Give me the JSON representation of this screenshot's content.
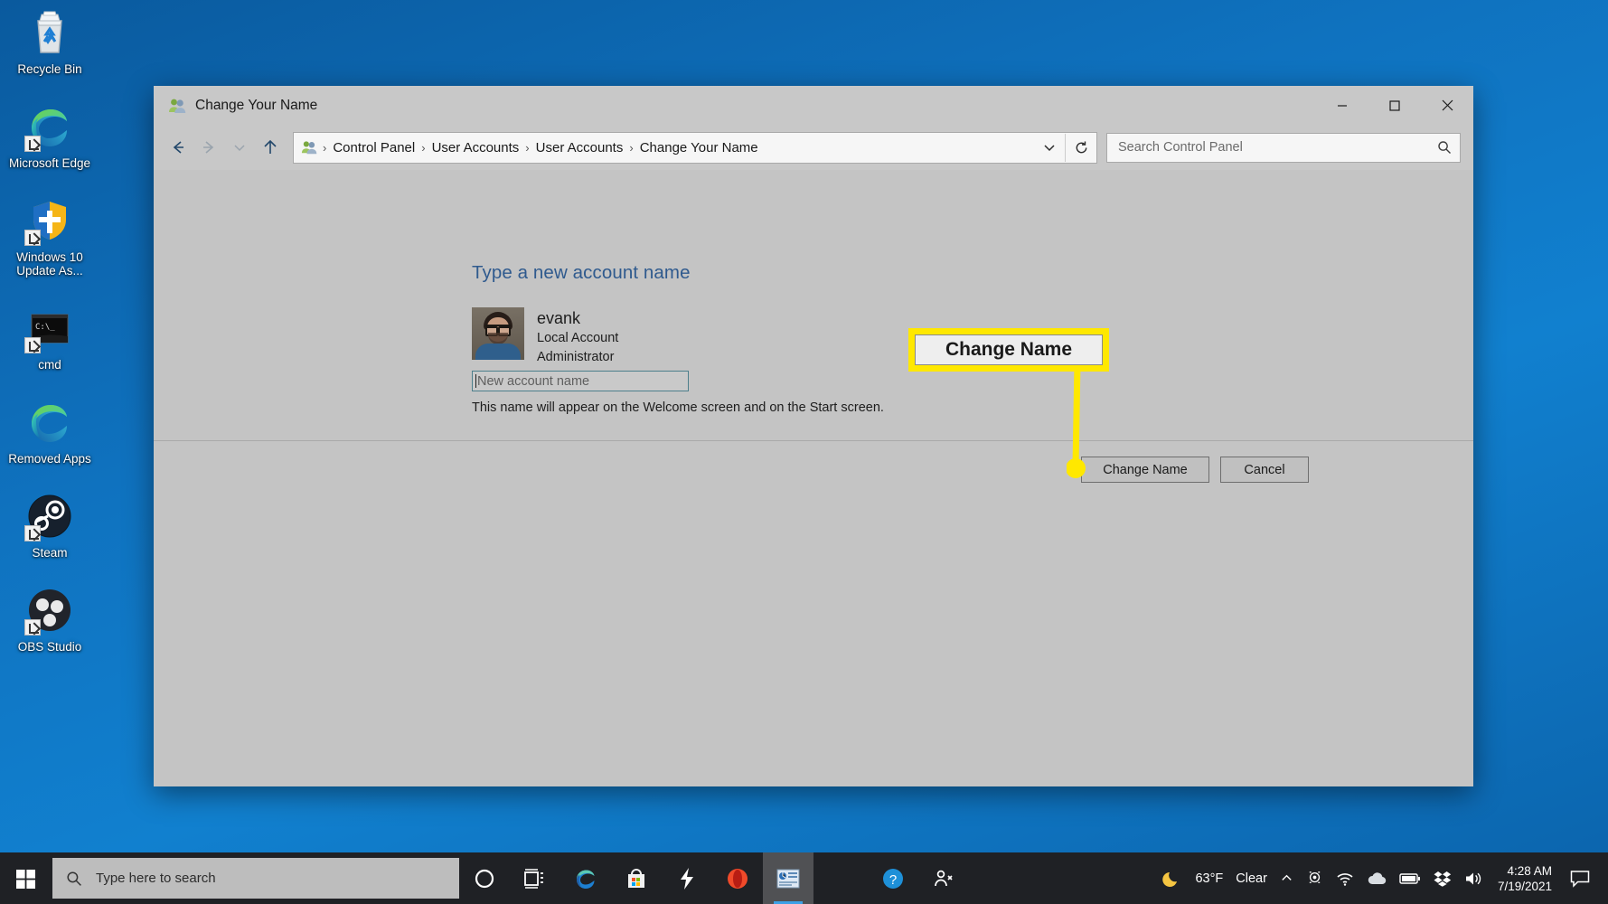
{
  "desktop": {
    "icons": [
      {
        "label": "Recycle Bin",
        "icon": "recycle-bin-icon",
        "shortcut": false
      },
      {
        "label": "Microsoft Edge",
        "icon": "microsoft-edge-icon",
        "shortcut": true
      },
      {
        "label": "Windows 10 Update As...",
        "icon": "windows-defender-shield-icon",
        "shortcut": true
      },
      {
        "label": "cmd",
        "icon": "command-prompt-icon",
        "shortcut": true
      },
      {
        "label": "Removed Apps",
        "icon": "microsoft-edge-icon",
        "shortcut": false
      },
      {
        "label": "Steam",
        "icon": "steam-icon",
        "shortcut": true
      },
      {
        "label": "OBS Studio",
        "icon": "obs-studio-icon",
        "shortcut": true
      }
    ],
    "background_color": "#0f72bf"
  },
  "window": {
    "title": "Change Your Name",
    "title_icon": "user-accounts-icon",
    "controls": {
      "minimize": "minimize-button",
      "maximize": "maximize-button",
      "close": "close-button"
    },
    "nav": {
      "back": "back-button",
      "forward": "forward-button",
      "recent": "recent-locations-button",
      "up": "up-button"
    },
    "breadcrumb": {
      "icon": "user-accounts-icon",
      "separator": "›",
      "items": [
        "Control Panel",
        "User Accounts",
        "User Accounts",
        "Change Your Name"
      ]
    },
    "address_dropdown": "previous-locations-chevron",
    "refresh": "refresh-button",
    "search": {
      "placeholder": "Search Control Panel",
      "icon": "search-icon"
    }
  },
  "main": {
    "heading": "Type a new account name",
    "account": {
      "name": "evank",
      "type": "Local Account",
      "role": "Administrator",
      "avatar": "user-avatar"
    },
    "input": {
      "placeholder": "New account name",
      "value": ""
    },
    "hint": "This name will appear on the Welcome screen and on the Start screen.",
    "buttons": {
      "change_name": "Change Name",
      "cancel": "Cancel"
    }
  },
  "annotation": {
    "callout_label": "Change Name",
    "highlight_color": "#ffe800",
    "line_color": "#ffe800"
  },
  "taskbar": {
    "start": "windows-start-button",
    "search": {
      "placeholder": "Type here to search",
      "icon": "search-icon"
    },
    "items": [
      {
        "name": "cortana-icon",
        "active": false
      },
      {
        "name": "task-view-icon",
        "active": false
      },
      {
        "name": "microsoft-edge-icon",
        "active": false
      },
      {
        "name": "microsoft-store-icon",
        "active": false
      },
      {
        "name": "lightning-app-icon",
        "active": false
      },
      {
        "name": "opera-browser-icon",
        "active": false
      },
      {
        "name": "control-panel-icon",
        "active": true
      },
      {
        "name": "help-support-icon",
        "active": false
      },
      {
        "name": "people-icon",
        "active": false
      }
    ],
    "weather": {
      "icon": "moon-icon",
      "temperature": "63°F",
      "condition": "Clear"
    },
    "tray": [
      {
        "name": "show-hidden-icons-chevron"
      },
      {
        "name": "webcam-icon"
      },
      {
        "name": "wifi-icon"
      },
      {
        "name": "onedrive-cloud-icon"
      },
      {
        "name": "battery-icon"
      },
      {
        "name": "dropbox-icon"
      },
      {
        "name": "volume-icon"
      }
    ],
    "clock": {
      "time": "4:28 AM",
      "date": "7/19/2021"
    },
    "action_center": "action-center-icon"
  }
}
